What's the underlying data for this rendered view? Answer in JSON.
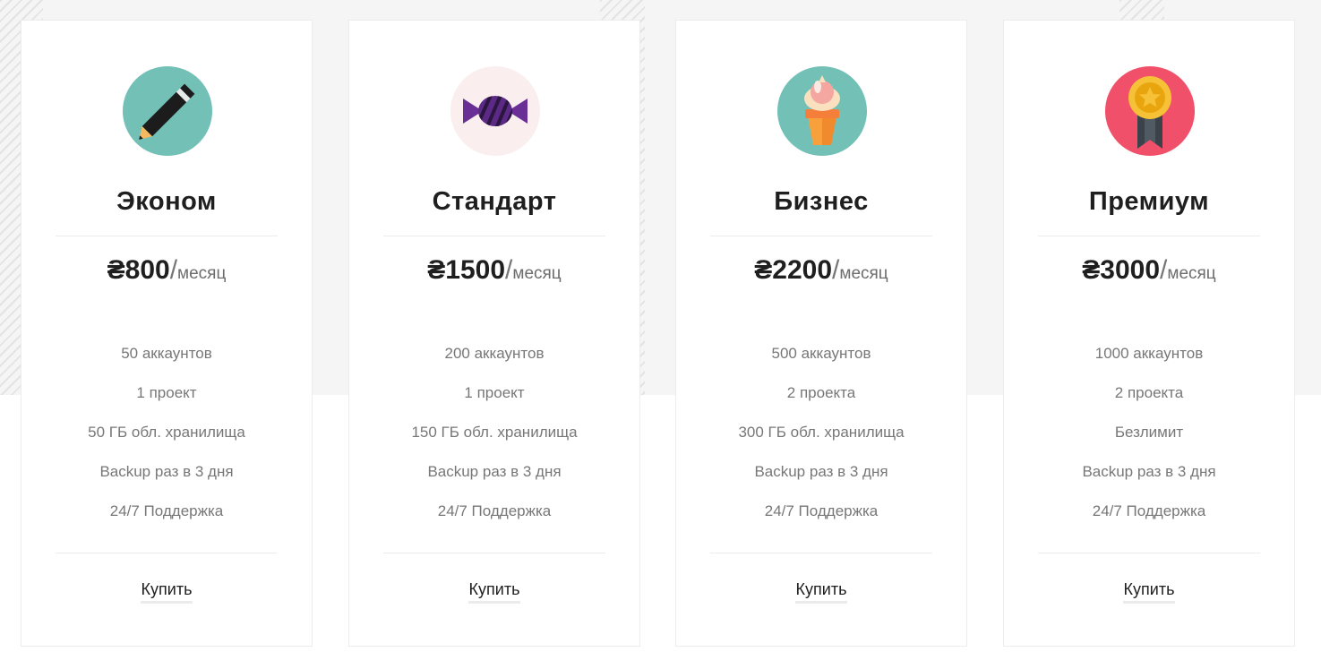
{
  "plans": [
    {
      "name": "Эконом",
      "price": "₴800",
      "per": "/",
      "period": "месяц",
      "icon": "pencil-icon",
      "icon_bg": "#72c0b6",
      "features": [
        "50 аккаунтов",
        "1 проект",
        "50 ГБ обл. хранилища",
        "Backup раз в 3 дня",
        "24/7 Поддержка"
      ],
      "buy_label": "Купить"
    },
    {
      "name": "Стандарт",
      "price": "₴1500",
      "per": "/",
      "period": "месяц",
      "icon": "candy-icon",
      "icon_bg": "#fbeeee",
      "features": [
        "200 аккаунтов",
        "1 проект",
        "150 ГБ обл. хранилища",
        "Backup раз в 3 дня",
        "24/7 Поддержка"
      ],
      "buy_label": "Купить"
    },
    {
      "name": "Бизнес",
      "price": "₴2200",
      "per": "/",
      "period": "месяц",
      "icon": "ice-cream-icon",
      "icon_bg": "#72c0b6",
      "features": [
        "500 аккаунтов",
        "2 проекта",
        "300 ГБ обл. хранилища",
        "Backup раз в 3 дня",
        "24/7 Поддержка"
      ],
      "buy_label": "Купить"
    },
    {
      "name": "Премиум",
      "price": "₴3000",
      "per": "/",
      "period": "месяц",
      "icon": "medal-icon",
      "icon_bg": "#f1506a",
      "features": [
        "1000 аккаунтов",
        "2 проекта",
        "Безлимит",
        "Backup раз в 3 дня",
        "24/7 Поддержка"
      ],
      "buy_label": "Купить"
    }
  ],
  "colors": {
    "background_top": "#f5f5f5",
    "card_border": "#ececec",
    "heading": "#1f1f1f",
    "muted_text": "#777777"
  }
}
